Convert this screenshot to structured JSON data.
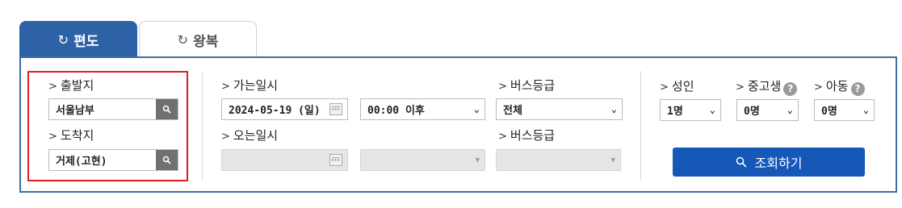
{
  "tabs": [
    {
      "label": "편도",
      "icon": "refresh-icon",
      "active": true
    },
    {
      "label": "왕복",
      "icon": "refresh-icon",
      "active": false
    }
  ],
  "departure": {
    "label": "출발지",
    "value": "서울남부"
  },
  "arrival": {
    "label": "도착지",
    "value": "거제(고현)"
  },
  "go": {
    "label": "가는일시",
    "date": "2024-05-19 (일)",
    "time": "00:00 이후"
  },
  "return": {
    "label": "오는일시",
    "date": "",
    "time": ""
  },
  "bus_grade_go": {
    "label": "버스등급",
    "value": "전체"
  },
  "bus_grade_return": {
    "label": "버스등급",
    "value": ""
  },
  "passengers": {
    "adult": {
      "label": "성인",
      "value": "1명"
    },
    "teen": {
      "label": "중고생",
      "value": "0명"
    },
    "child": {
      "label": "아동",
      "value": "0명"
    }
  },
  "search_button": {
    "label": "조회하기"
  },
  "colors": {
    "tab_active": "#2e62a6",
    "panel_border": "#3b6fa6",
    "highlight": "#e01d1d",
    "primary_button": "#1558b8"
  }
}
